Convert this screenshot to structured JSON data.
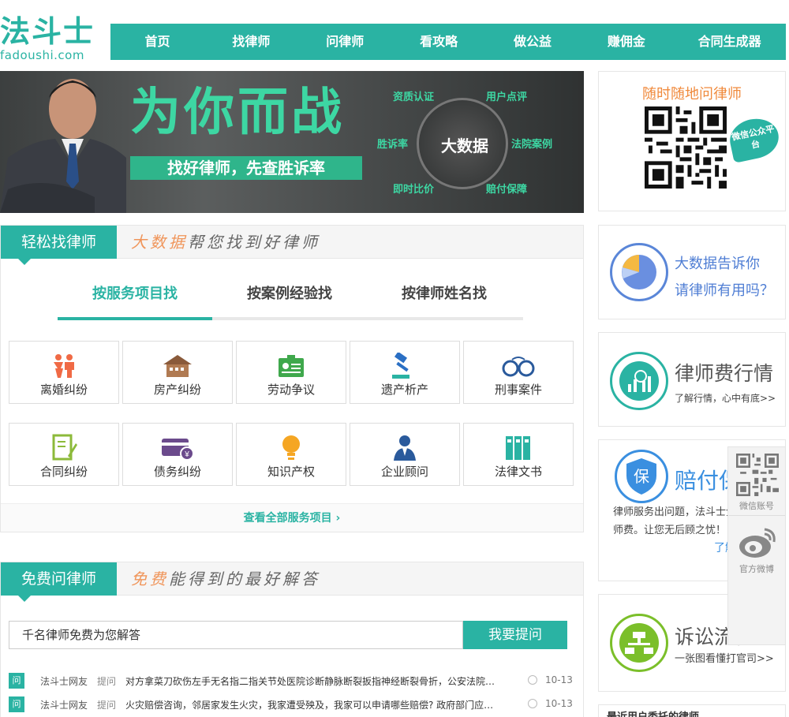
{
  "logo": {
    "cn": "法斗士",
    "en": "fadoushi.com"
  },
  "nav": [
    "首页",
    "找律师",
    "问律师",
    "看攻略",
    "做公益",
    "赚佣金",
    "合同生成器"
  ],
  "banner": {
    "title": "为你而战",
    "slogan": "找好律师，先查胜诉率",
    "center": "大数据",
    "tags": [
      "资质认证",
      "用户点评",
      "胜诉率",
      "法院案例",
      "即时比价",
      "赔付保障"
    ]
  },
  "find_lawyer": {
    "tag": "轻松找律师",
    "slogan_hi": "大数据",
    "slogan_rest": "帮您找到好律师",
    "tabs": [
      "按服务项目找",
      "按案例经验找",
      "按律师姓名找"
    ],
    "services": [
      "离婚纠纷",
      "房产纠纷",
      "劳动争议",
      "遗产析产",
      "刑事案件",
      "合同纠纷",
      "债务纠纷",
      "知识产权",
      "企业顾问",
      "法律文书"
    ],
    "more": "查看全部服务项目 ›"
  },
  "ask_lawyer": {
    "tag": "免费问律师",
    "slogan_hi": "免费",
    "slogan_rest": "能得到的最好解答",
    "input_value": "千名律师免费为您解答",
    "button": "我要提问",
    "questions": [
      {
        "badge": "问",
        "user": "法斗士网友",
        "action": "提问",
        "text": "对方拿菜刀砍伤左手无名指二指关节处医院诊断静脉断裂扳指神经断裂骨折，公安法院…",
        "date": "10-13"
      },
      {
        "badge": "问",
        "user": "法斗士网友",
        "action": "提问",
        "text": "火灾赔偿咨询，邻居家发生火灾，我家遭受殃及，我家可以申请哪些赔偿? 政府部门应…",
        "date": "10-13"
      }
    ]
  },
  "sidebar": {
    "qr_title": "随时随地问律师",
    "wx_badge": "微信公众平台",
    "bigdata_line1": "大数据告诉你",
    "bigdata_line2": "请律师有用吗？",
    "fee_title": "律师费行情",
    "fee_sub": "了解行情，心中有底>>",
    "pay_title": "赔付保障",
    "pay_text": "律师服务出问题，法斗士全额赔付律师费。让您无后顾之忧！",
    "pay_link": "了解",
    "lit_title": "诉讼流程",
    "lit_sub": "一张图看懂打官司>>",
    "recent": "最近用户委托的律师"
  },
  "float": {
    "wechat": "微信账号",
    "weibo": "官方微博"
  },
  "colors": {
    "accent": "#2ab3a3",
    "orange": "#f08a3c",
    "banner_green": "#3dd7a3"
  }
}
